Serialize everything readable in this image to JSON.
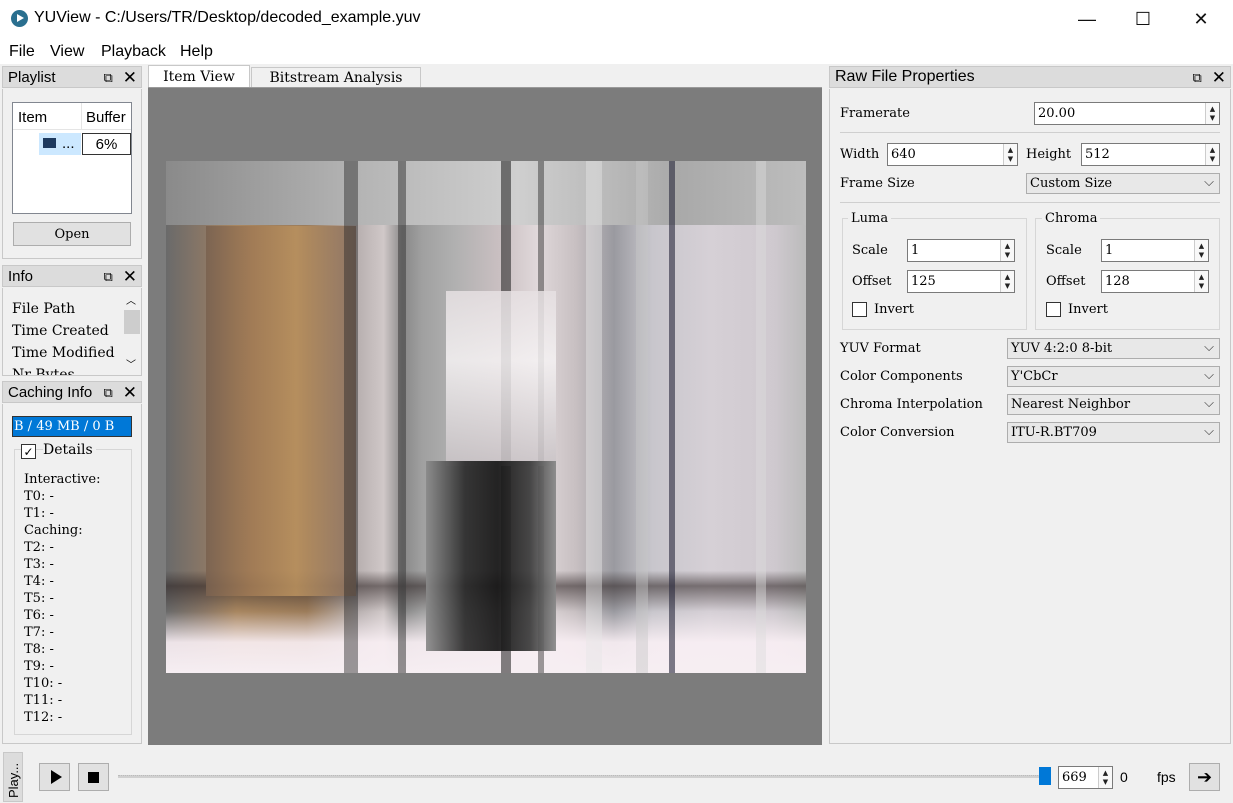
{
  "window": {
    "title": "YUView - C:/Users/TR/Desktop/decoded_example.yuv",
    "minimize": "—",
    "maximize": "☐",
    "close": "✕"
  },
  "menu": [
    "File",
    "View",
    "Playback",
    "Help"
  ],
  "playlist": {
    "title": "Playlist",
    "col_item": "Item",
    "col_buffer": "Buffer",
    "row_name": "...",
    "row_buffer": "6%",
    "open_label": "Open"
  },
  "info": {
    "title": "Info",
    "rows": [
      "File Path",
      "Time Created",
      "Time Modified",
      "Nr Bytes"
    ]
  },
  "caching": {
    "title": "Caching Info",
    "bar_text": "B / 49 MB / 0 B",
    "details_label": "Details",
    "details_checked": true,
    "lines": [
      "Interactive:",
      "T0: -",
      "T1: -",
      "Caching:",
      "T2: -",
      "T3: -",
      "T4: -",
      "T5: -",
      "T6: -",
      "T7: -",
      "T8: -",
      "T9: -",
      "T10: -",
      "T11: -",
      "T12: -"
    ]
  },
  "tabs": [
    "Item View",
    "Bitstream Analysis"
  ],
  "raw_props": {
    "title": "Raw File Properties",
    "framerate_label": "Framerate",
    "framerate": "20.00",
    "width_label": "Width",
    "width": "640",
    "height_label": "Height",
    "height": "512",
    "frame_size_label": "Frame Size",
    "frame_size": "Custom Size",
    "luma": {
      "title": "Luma",
      "scale_label": "Scale",
      "scale": "1",
      "offset_label": "Offset",
      "offset": "125",
      "invert_label": "Invert"
    },
    "chroma": {
      "title": "Chroma",
      "scale_label": "Scale",
      "scale": "1",
      "offset_label": "Offset",
      "offset": "128",
      "invert_label": "Invert"
    },
    "yuv_format_label": "YUV Format",
    "yuv_format": "YUV 4:2:0 8-bit",
    "color_components_label": "Color Components",
    "color_components": "Y'CbCr",
    "chroma_interp_label": "Chroma Interpolation",
    "chroma_interp": "Nearest Neighbor",
    "color_conversion_label": "Color Conversion",
    "color_conversion": "ITU-R.BT709"
  },
  "playback": {
    "frame": "669",
    "zero": "0",
    "fps": "fps",
    "side_tab": "Play..."
  }
}
